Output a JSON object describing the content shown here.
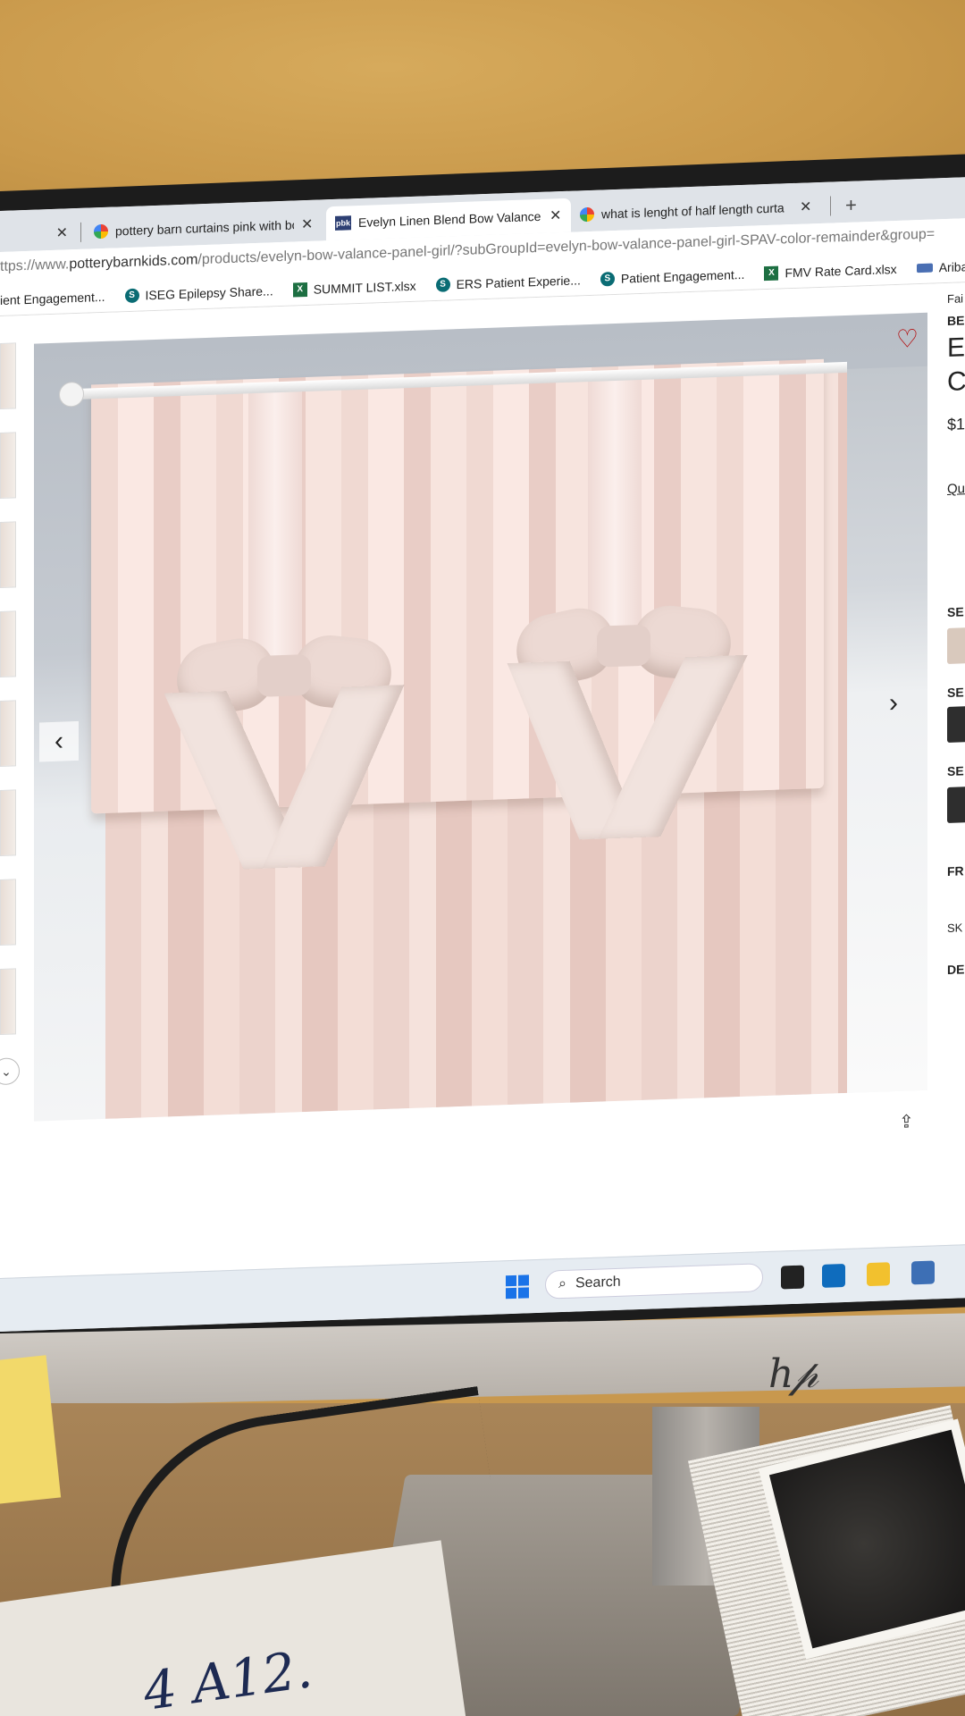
{
  "browser": {
    "tabs": [
      {
        "label": "",
        "icon": "",
        "active": false
      },
      {
        "label": "pottery barn curtains pink with bo",
        "icon": "google-icon",
        "active": false
      },
      {
        "label": "Evelyn Linen Blend Bow Valance",
        "icon": "pbk-icon",
        "active": true
      },
      {
        "label": "what is lenght of half length curta",
        "icon": "google-icon",
        "active": false
      }
    ],
    "close_glyph": "✕",
    "new_tab_glyph": "+",
    "url_prefix": "ttps://www.",
    "url_host": "potterybarnkids.com",
    "url_path": "/products/evelyn-bow-valance-panel-girl/?subGroupId=evelyn-bow-valance-panel-girl-SPAV-color-remainder&group=",
    "bookmarks": [
      {
        "label": "ient Engagement...",
        "icon": "none"
      },
      {
        "label": "ISEG Epilepsy Share...",
        "icon": "sharepoint-icon"
      },
      {
        "label": "SUMMIT LIST.xlsx",
        "icon": "excel-icon"
      },
      {
        "label": "ERS Patient Experie...",
        "icon": "sharepoint-icon"
      },
      {
        "label": "Patient Engagement...",
        "icon": "sharepoint-icon"
      },
      {
        "label": "FMV Rate Card.xlsx",
        "icon": "excel-icon"
      },
      {
        "label": "Ariba Guide",
        "icon": "ariba-icon"
      }
    ],
    "pbk_icon_text": "pbk",
    "sp_icon_text": "S",
    "xl_icon_text": "X"
  },
  "product": {
    "side_texts": [
      "Fai",
      "BE",
      "E",
      "C",
      "$1",
      "Qu",
      "SE",
      "SE",
      "SE",
      "FR",
      "SK",
      "DE"
    ],
    "thumbnail_more_glyph": "⌄",
    "prev_glyph": "‹",
    "next_glyph": "›",
    "wishlist_glyph": "♡",
    "share_glyph": "⇪"
  },
  "taskbar": {
    "search_placeholder": "Search",
    "search_icon": "search-icon"
  },
  "hardware": {
    "brand": "hp",
    "note_text": "4 A12."
  },
  "colors": {
    "accent_blue": "#1a73e8",
    "pbk_navy": "#2d3f73",
    "heart_red": "#b30000"
  }
}
